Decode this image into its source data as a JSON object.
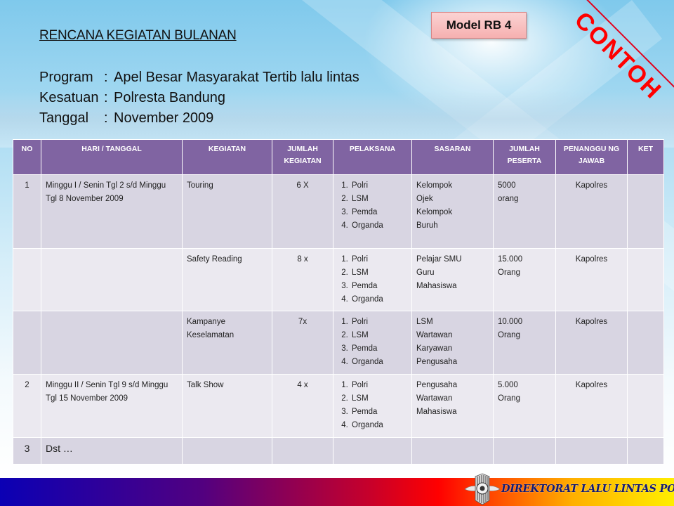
{
  "header": {
    "title": "RENCANA KEGIATAN BULANAN",
    "meta": [
      {
        "label": "Program",
        "sep": ":",
        "value": "Apel Besar Masyarakat Tertib lalu lintas"
      },
      {
        "label": "Kesatuan",
        "sep": ":",
        "value": "Polresta Bandung"
      },
      {
        "label": "Tanggal",
        "sep": ":",
        "value": "November 2009"
      }
    ],
    "model_badge": "Model RB 4",
    "watermark": "CONTOH"
  },
  "table": {
    "columns": [
      "NO",
      "HARI / TANGGAL",
      "KEGIATAN",
      "JUMLAH KEGIATAN",
      "PELAKSANA",
      "SASARAN",
      "JUMLAH PESERTA",
      "PENANGGU NG JAWAB",
      "KET"
    ],
    "rows": [
      {
        "no": "1",
        "hari_tanggal": "Minggu I / Senin Tgl 2 s/d Minggu Tgl 8 November 2009",
        "kegiatan": "Touring",
        "jumlah_kegiatan": "6 X",
        "pelaksana": [
          "Polri",
          "LSM",
          "Pemda",
          "Organda"
        ],
        "sasaran": [
          "Kelompok",
          "Ojek",
          "Kelompok",
          "Buruh"
        ],
        "jumlah_peserta": [
          "5000",
          "orang"
        ],
        "penanggung_jawab": "Kapolres",
        "ket": ""
      },
      {
        "no": "",
        "hari_tanggal": "",
        "kegiatan": "Safety Reading",
        "jumlah_kegiatan": "8 x",
        "pelaksana": [
          "Polri",
          "LSM",
          "Pemda",
          "Organda"
        ],
        "sasaran": [
          "Pelajar SMU",
          "Guru",
          "Mahasiswa"
        ],
        "jumlah_peserta": [
          "15.000",
          "Orang"
        ],
        "penanggung_jawab": "Kapolres",
        "ket": ""
      },
      {
        "no": "",
        "hari_tanggal": "",
        "kegiatan": "Kampanye Keselamatan",
        "jumlah_kegiatan": "7x",
        "pelaksana": [
          "Polri",
          "LSM",
          "Pemda",
          "Organda"
        ],
        "sasaran": [
          "LSM",
          "Wartawan",
          "Karyawan",
          "Pengusaha"
        ],
        "jumlah_peserta": [
          "10.000",
          "Orang"
        ],
        "penanggung_jawab": "Kapolres",
        "ket": ""
      },
      {
        "no": "2",
        "hari_tanggal": "Minggu II / Senin  Tgl 9 s/d Minggu Tgl 15 November 2009",
        "kegiatan": "Talk Show",
        "jumlah_kegiatan": "4 x",
        "pelaksana": [
          "Polri",
          "LSM",
          "Pemda",
          "Organda"
        ],
        "sasaran": [
          "Pengusaha",
          "Wartawan",
          "Mahasiswa"
        ],
        "jumlah_peserta": [
          "5.000",
          "Orang"
        ],
        "penanggung_jawab": "Kapolres",
        "ket": ""
      },
      {
        "no": "3",
        "hari_tanggal": "Dst …",
        "kegiatan": "",
        "jumlah_kegiatan": "",
        "pelaksana": [],
        "sasaran": [],
        "jumlah_peserta": [],
        "penanggung_jawab": "",
        "ket": ""
      }
    ]
  },
  "footer": {
    "banner_text": "DIREKTORAT LALU LINTAS POLRI",
    "logo_icon": "police-emblem-icon"
  },
  "colors": {
    "header_bg": "#8064a2",
    "row_dark": "#d8d5e2",
    "row_light": "#ebe9f0",
    "watermark": "#ff0000",
    "badge_bg": "#f6b0b0"
  }
}
